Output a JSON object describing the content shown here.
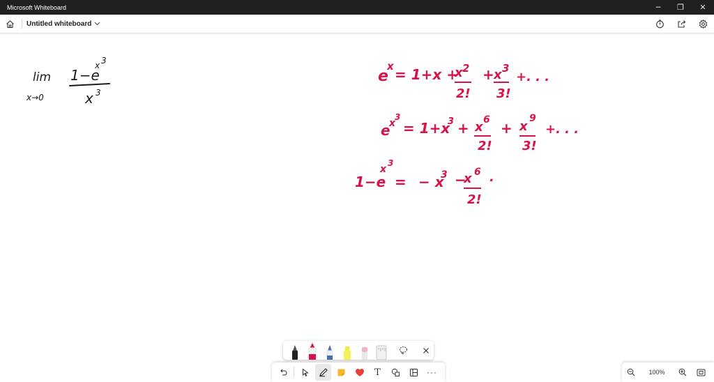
{
  "window": {
    "title": "Microsoft Whiteboard",
    "minimize_glyph": "─",
    "restore_glyph": "❐",
    "close_glyph": "✕"
  },
  "appbar": {
    "board_title": "Untitled whiteboard",
    "home_icon": "home-icon",
    "timer_icon": "timer-icon",
    "share_icon": "share-icon",
    "settings_icon": "gear-icon"
  },
  "ink": {
    "color_black": "#1a1a1a",
    "color_red": "#d5144a",
    "black_lim": "lim",
    "black_sub": "x→0",
    "black_numerator": "1−e",
    "black_num_exp": "x",
    "black_num_exp_exp": "3",
    "black_denominator": "x",
    "black_den_exp": "3",
    "l1_e": "e",
    "l1_exp": "x",
    "l1_body": "= 1+x +",
    "l1_t2": "x",
    "l1_t2e": "2",
    "l1_f2": "2!",
    "l1_plus": "+",
    "l1_t3": "x",
    "l1_t3e": "3",
    "l1_f3": "3!",
    "l1_tail": "+. . .",
    "l2_e": "e",
    "l2_exp": "x",
    "l2_exp2": "3",
    "l2_body": "= 1+x",
    "l2_body_e": "3",
    "l2_plus": "+",
    "l2_t6": "x",
    "l2_t6e": "6",
    "l2_f2": "2!",
    "l2_plus2": "+",
    "l2_t9": "x",
    "l2_t9e": "9",
    "l2_f3": "3!",
    "l2_tail": "+. . .",
    "l3_left": "1−e",
    "l3_exp": "x",
    "l3_exp2": "3",
    "l3_eq": "=",
    "l3_a": "− x",
    "l3_ae": "3",
    "l3_minus": "−",
    "l3_b": "x",
    "l3_be": "6",
    "l3_f2": "2!",
    "l3_dot": "."
  },
  "pens": {
    "items": [
      {
        "name": "black-pen",
        "color": "#222222"
      },
      {
        "name": "red-pen",
        "color": "#d5144a"
      },
      {
        "name": "blue-pen",
        "color": "#4a6ea9"
      },
      {
        "name": "highlighter-yellow",
        "color": "#f2ef3a"
      },
      {
        "name": "eraser-pink",
        "color": "#f0b5c0"
      },
      {
        "name": "ruler",
        "color": "#bfbfbf"
      }
    ],
    "lasso_icon": "lasso-icon",
    "close_icon": "close-icon"
  },
  "toolbar": {
    "undo_icon": "undo-icon",
    "select_icon": "select-icon",
    "pen_icon": "pen-icon",
    "note_icon": "sticky-note-icon",
    "reaction_icon": "heart-icon",
    "text_label": "T",
    "shapes_icon": "shapes-icon",
    "templates_icon": "templates-icon",
    "more_label": "···"
  },
  "zoom": {
    "level": "100%",
    "zoom_out_icon": "zoom-out-icon",
    "zoom_in_icon": "zoom-in-icon",
    "fit_icon": "fit-view-icon"
  }
}
